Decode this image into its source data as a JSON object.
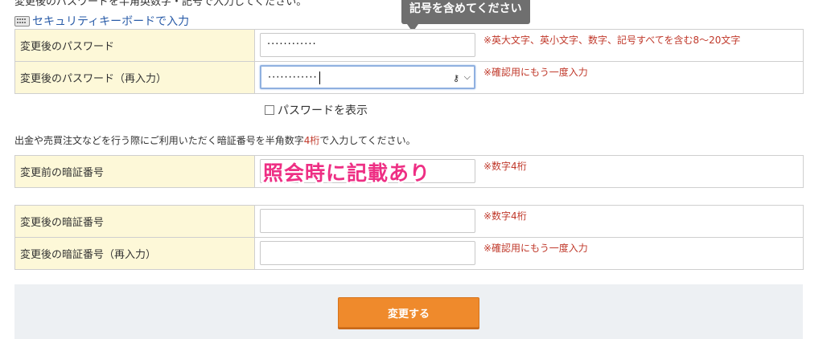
{
  "header": {
    "cut_text": "変更後のパスワードを半角英数字・記号で入力してください。",
    "keyboard_link": "セキュリティキーボードで入力",
    "tooltip": "記号を含めてください"
  },
  "password_form": {
    "rows": [
      {
        "label": "変更後のパスワード",
        "value": "············",
        "note": "※英大文字、英小文字、数字、記号すべてを含む8〜20文字"
      },
      {
        "label": "変更後のパスワード（再入力）",
        "value": "············",
        "note": "※確認用にもう一度入力"
      }
    ],
    "key_icon_glyph": "⚷",
    "chevron_glyph": "⌵"
  },
  "show_password": {
    "label": "パスワードを表示"
  },
  "pin_description": {
    "before": "出金や売買注文などを行う際にご利用いただく暗証番号を半角数字",
    "highlight": "4桁",
    "after": "で入力してください。"
  },
  "current_pin": {
    "label": "変更前の暗証番号",
    "note": "※数字4桁"
  },
  "overlay_text": "照会時に記載あり",
  "new_pin": {
    "rows": [
      {
        "label": "変更後の暗証番号",
        "note": "※数字4桁"
      },
      {
        "label": "変更後の暗証番号（再入力）",
        "note": "※確認用にもう一度入力"
      }
    ]
  },
  "submit": {
    "label": "変更する"
  },
  "colors": {
    "label_bg": "#fdf8d8",
    "note": "#c0392b",
    "button": "#ef8a2c",
    "link": "#2a5ca8",
    "overlay": "#ee2f84"
  }
}
